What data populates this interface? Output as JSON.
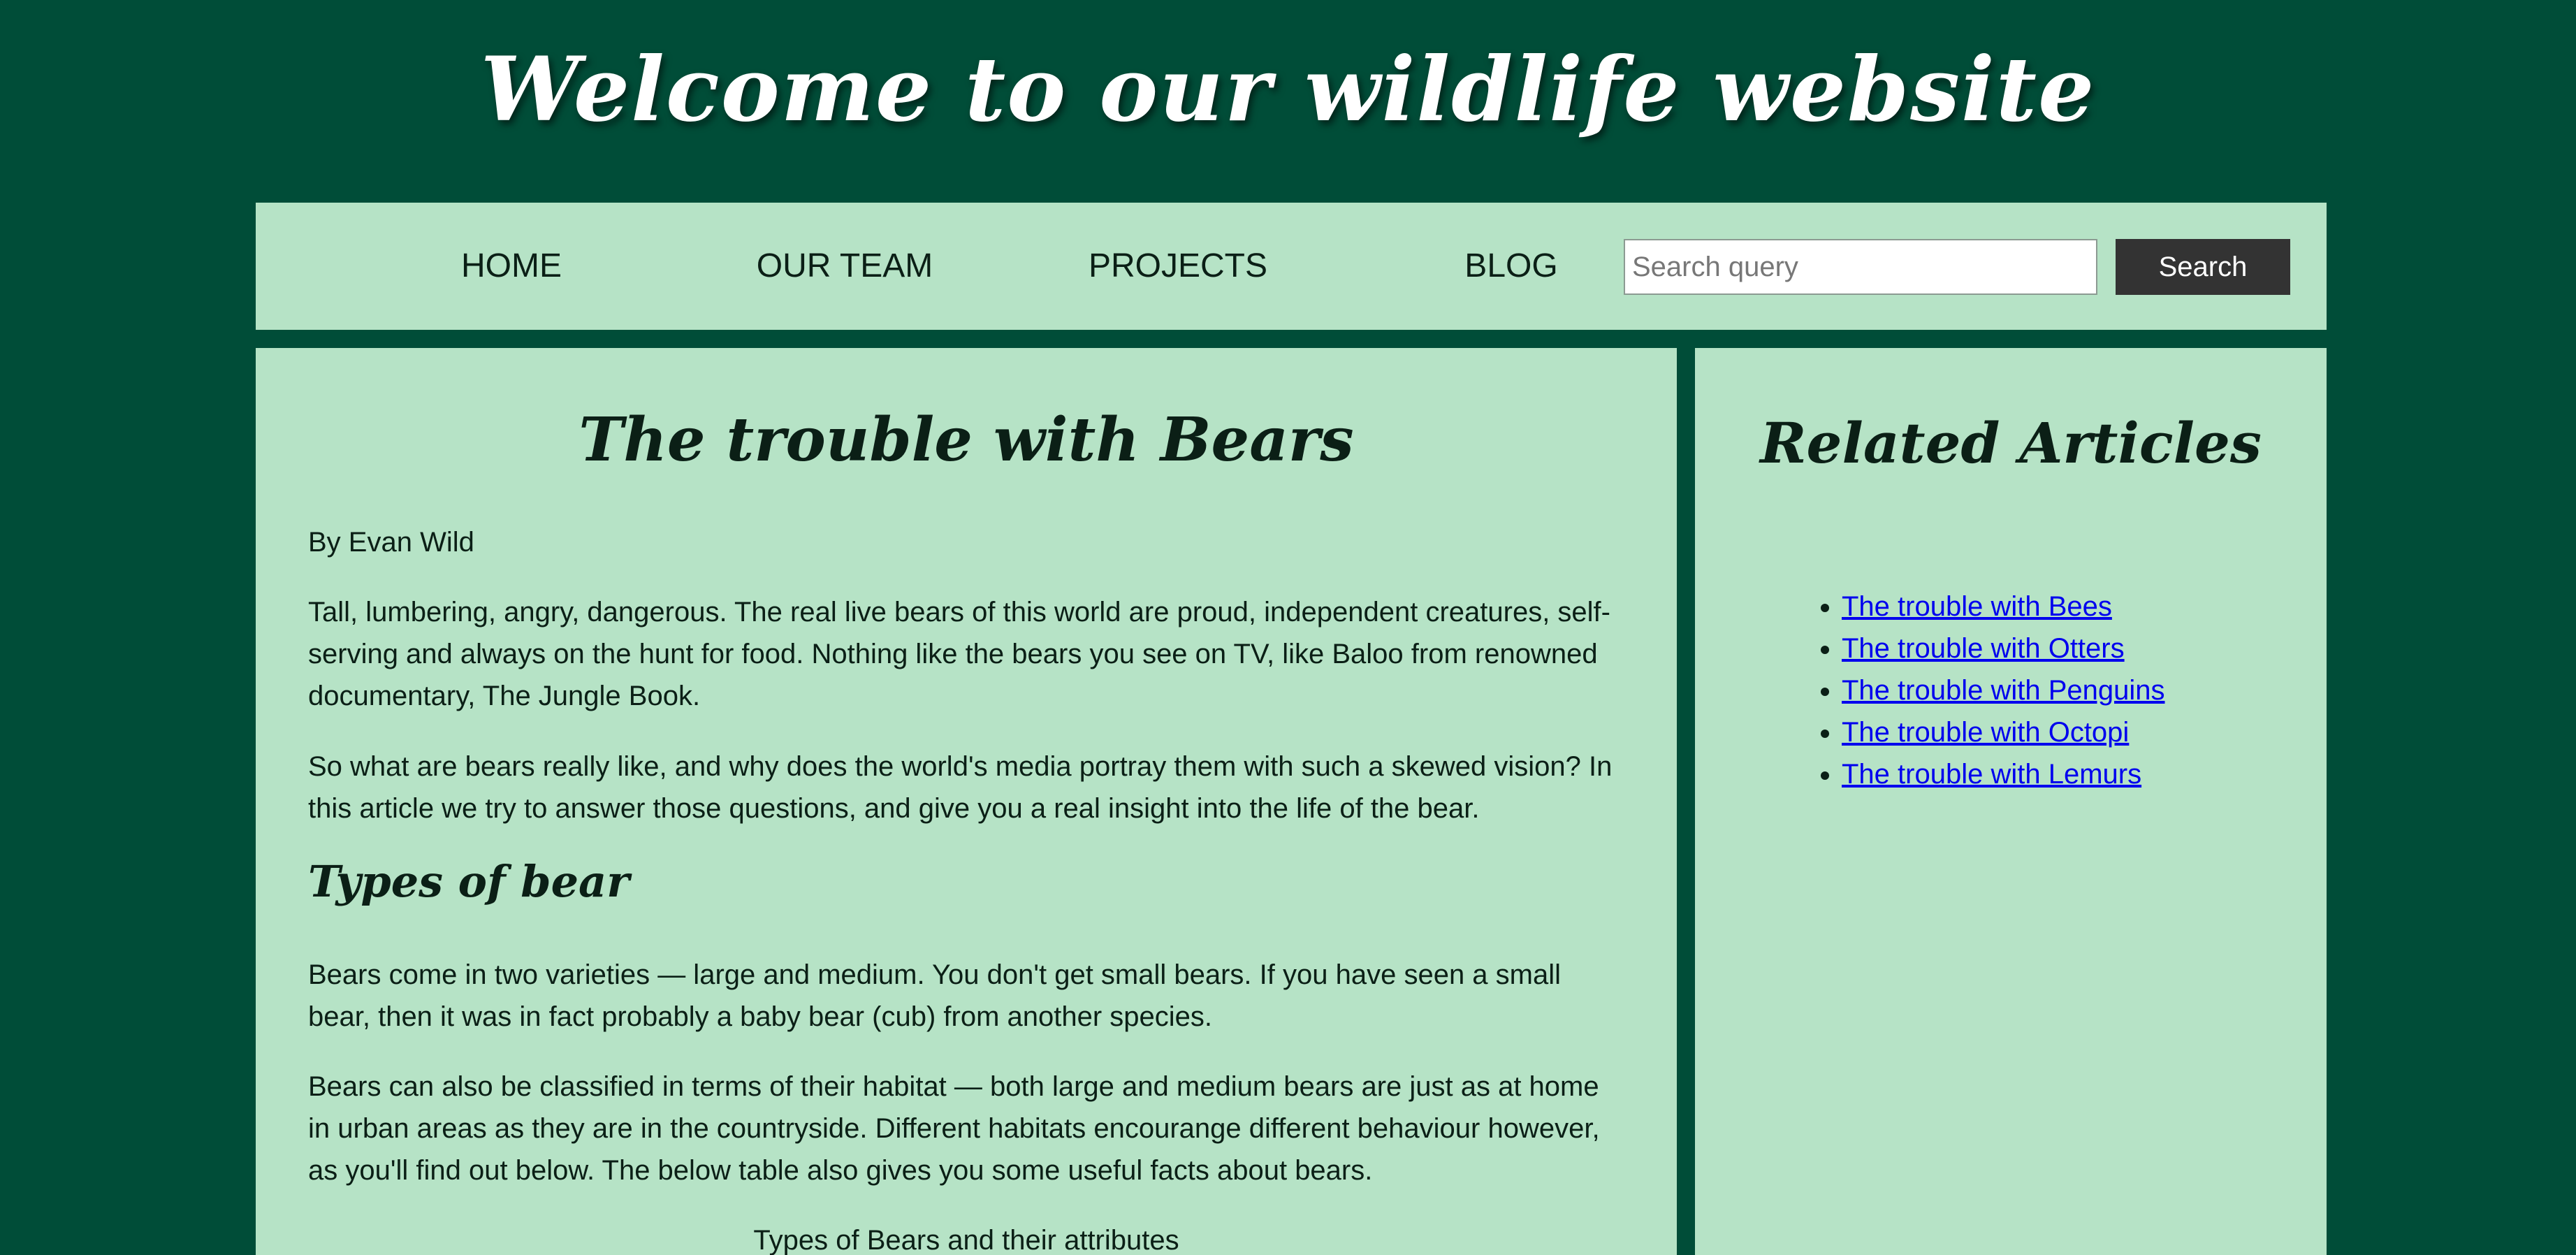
{
  "header": {
    "title": "Welcome to our wildlife website"
  },
  "nav": {
    "items": [
      {
        "label": "HOME"
      },
      {
        "label": "OUR TEAM"
      },
      {
        "label": "PROJECTS"
      },
      {
        "label": "BLOG"
      }
    ],
    "search": {
      "placeholder": "Search query",
      "value": "",
      "button_label": "Search"
    }
  },
  "article": {
    "title": "The trouble with Bears",
    "byline": "By Evan Wild",
    "paragraphs": [
      "Tall, lumbering, angry, dangerous. The real live bears of this world are proud, independent creatures, self-serving and always on the hunt for food. Nothing like the bears you see on TV, like Baloo from renowned documentary, The Jungle Book.",
      "So what are bears really like, and why does the world's media portray them with such a skewed vision? In this article we try to answer those questions, and give you a real insight into the life of the bear."
    ],
    "section": {
      "heading": "Types of bear",
      "paragraphs": [
        "Bears come in two varieties — large and medium. You don't get small bears. If you have seen a small bear, then it was in fact probably a baby bear (cub) from another species.",
        "Bears can also be classified in terms of their habitat — both large and medium bears are just as at home in urban areas as they are in the countryside. Different habitats encourange different behaviour however, as you'll find out below. The below table also gives you some useful facts about bears."
      ],
      "table_caption": "Types of Bears and their attributes"
    }
  },
  "aside": {
    "title": "Related Articles",
    "links": [
      {
        "label": "The trouble with Bees"
      },
      {
        "label": "The trouble with Otters"
      },
      {
        "label": "The trouble with Penguins"
      },
      {
        "label": "The trouble with Octopi"
      },
      {
        "label": "The trouble with Lemurs"
      }
    ]
  },
  "colors": {
    "page_background": "#004d38",
    "panel_background": "#b6e3c6",
    "search_button": "#333333",
    "link": "#0000ee"
  }
}
